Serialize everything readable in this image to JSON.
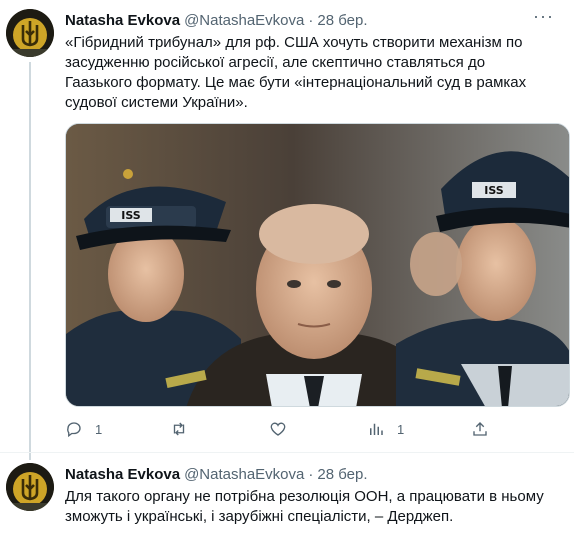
{
  "tweets": [
    {
      "author_name": "Natasha Evkova",
      "author_handle": "@NatashaEvkova",
      "separator": "·",
      "timestamp": "28 бер.",
      "more_icon": "more-dots-icon",
      "text": "«Гібридний трибунал» для рф. США хочуть створити механізм по засудженню російської агресії, але скептично ставляться до Гаазького формату. Це має бути «інтернаціональний суд в рамках судової системи України».",
      "actions": {
        "reply_count": "1",
        "retweet_count": "",
        "like_count": "",
        "views_count": "1"
      }
    },
    {
      "author_name": "Natasha Evkova",
      "author_handle": "@NatashaEvkova",
      "separator": "·",
      "timestamp": "28 бер.",
      "text": "Для такого органу не потрібна резолюція ООН, а працювати в ньому зможуть і українські, і зарубіжні спеціалісти, – Дерджеп."
    }
  ],
  "media": {
    "cap_badges": [
      "ISS",
      "ISS"
    ]
  },
  "colors": {
    "text_primary": "#0f1419",
    "text_secondary": "#536471",
    "thread_line": "#cfd9de"
  }
}
